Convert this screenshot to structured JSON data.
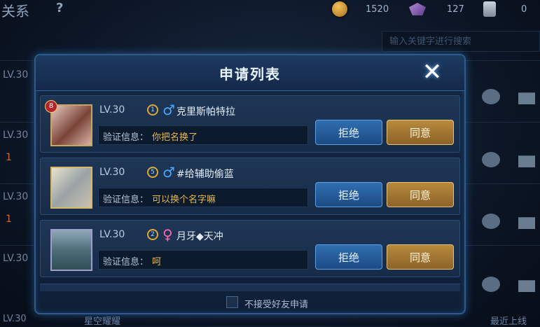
{
  "background": {
    "title": "关系",
    "help": "?",
    "resources": [
      {
        "icon": "gold-coin-icon",
        "value": "1520"
      },
      {
        "icon": "gem-icon",
        "value": "127"
      },
      {
        "icon": "card-icon",
        "value": "0"
      }
    ],
    "search_placeholder": "输入关键字进行搜索",
    "rows": [
      {
        "level": "LV.30",
        "heart": ""
      },
      {
        "level": "LV.30",
        "heart": "1"
      },
      {
        "level": "LV.30",
        "heart": "1"
      },
      {
        "level": "LV.30",
        "heart": ""
      }
    ],
    "bottom_level": "LV.30",
    "bottom_name": "星空耀耀",
    "bottom_right": "最近上线"
  },
  "dialog": {
    "title": "申请列表",
    "close_icon": "close-icon",
    "verify_label": "验证信息：",
    "reject_label": "拒绝",
    "accept_label": "同意",
    "requests": [
      {
        "level": "LV.30",
        "tier": "1",
        "gender": "♂",
        "name": "克里斯帕特拉",
        "message": "你把名换了",
        "badge": "8"
      },
      {
        "level": "LV.30",
        "tier": "5",
        "gender": "♂",
        "name": "#给辅助偷蓝",
        "message": "可以换个名字嘛",
        "badge": ""
      },
      {
        "level": "LV.30",
        "tier": "2",
        "gender": "♀",
        "name": "月牙◆天冲",
        "message": "呵",
        "badge": ""
      }
    ],
    "footer_checkbox_label": "不接受好友申请"
  },
  "colors": {
    "accent_gold": "#e7b84a",
    "reject_blue": "#2f6fb0",
    "accept_gold": "#b88a3c",
    "male": "#49a7ff",
    "female": "#ff66b0"
  }
}
